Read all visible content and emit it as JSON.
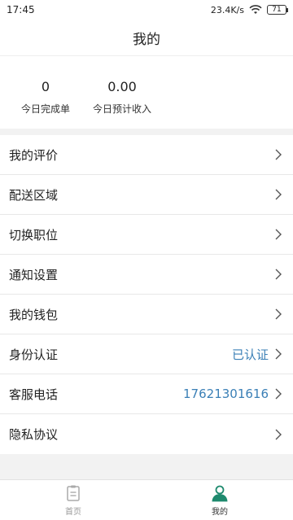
{
  "status_bar": {
    "time": "17:45",
    "net_speed": "23.4K/s",
    "battery": "71"
  },
  "header": {
    "title": "我的"
  },
  "stats": {
    "orders_value": "0",
    "orders_label": "今日完成单",
    "income_value": "0.00",
    "income_label": "今日预计收入"
  },
  "menu": {
    "items": [
      {
        "label": "我的评价",
        "value": ""
      },
      {
        "label": "配送区域",
        "value": ""
      },
      {
        "label": "切换职位",
        "value": ""
      },
      {
        "label": "通知设置",
        "value": ""
      },
      {
        "label": "我的钱包",
        "value": ""
      },
      {
        "label": "身份认证",
        "value": "已认证"
      },
      {
        "label": "客服电话",
        "value": "17621301616"
      },
      {
        "label": "隐私协议",
        "value": ""
      }
    ]
  },
  "bottom_nav": {
    "home_label": "首页",
    "mine_label": "我的"
  },
  "colors": {
    "accent": "#3a7fb6",
    "active_tab_icon": "#1e8a6e",
    "inactive": "#999999"
  },
  "icons": {
    "wifi": "wifi-icon",
    "battery": "battery-icon",
    "chevron": "chevron-right-icon",
    "home": "clipboard-icon",
    "mine": "person-icon"
  }
}
